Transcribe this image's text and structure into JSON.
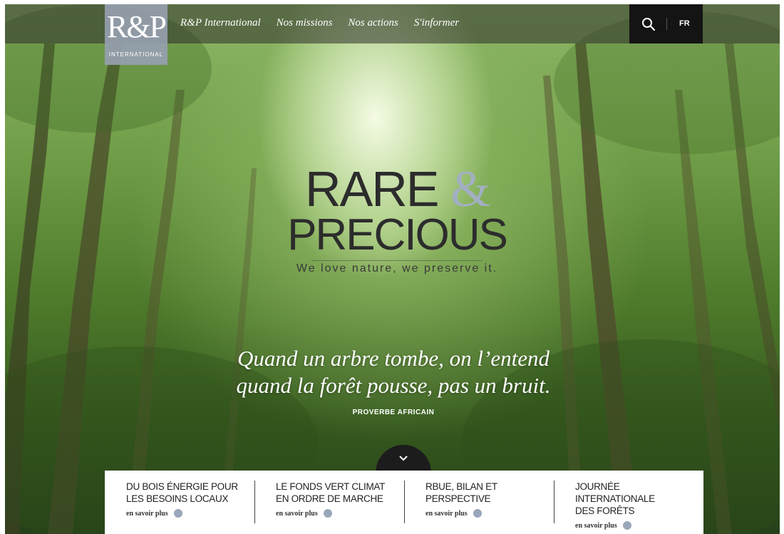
{
  "nav": {
    "logo_mark": "R&P",
    "logo_subtitle": "INTERNATIONAL",
    "links": [
      "R&P International",
      "Nos missions",
      "Nos actions",
      "S'informer"
    ],
    "language": "FR"
  },
  "hero": {
    "title_word1": "RARE",
    "title_amp": "&",
    "title_word2": "PRECIOUS",
    "tagline": "We love nature, we preserve it."
  },
  "quote": {
    "line1": "Quand un arbre tombe, on l’entend",
    "line2": "quand la forêt pousse, pas un bruit.",
    "author": "PROVERBE AFRICAIN"
  },
  "news": [
    {
      "title_line1": "DU BOIS ÉNERGIE POUR",
      "title_line2": "LES BESOINS LOCAUX",
      "more": "en savoir plus"
    },
    {
      "title_line1": "LE FONDS VERT CLIMAT",
      "title_line2": "EN ORDRE DE MARCHE",
      "more": "en savoir plus"
    },
    {
      "title_line1": "RBUE, BILAN ET",
      "title_line2": "PERSPECTIVE",
      "more": "en savoir plus"
    },
    {
      "title_line1": "JOURNÉE INTERNATIONALE",
      "title_line2": "DES FORÊTS",
      "more": "en savoir plus"
    }
  ],
  "colors": {
    "accent": "#9aa6ba",
    "nav_dark": "#141414"
  },
  "icons": {
    "search": "search-icon",
    "scroll": "chevron-down-icon",
    "more": "arrow-circle-icon"
  }
}
